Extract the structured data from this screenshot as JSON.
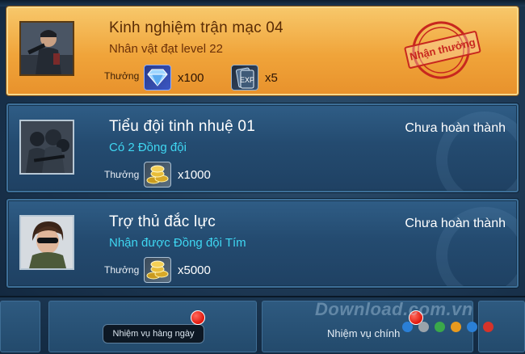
{
  "quests": [
    {
      "title": "Kinh nghiệm trận mạc 04",
      "subtitle": "Nhân vật đạt level 22",
      "reward_label": "Thưởng",
      "rewards": [
        {
          "icon": "diamond-icon",
          "count": "x100"
        },
        {
          "icon": "exp-card-icon",
          "count": "x5"
        }
      ],
      "action_label": "Nhận thưởng"
    },
    {
      "title": "Tiểu đội tinh nhuệ 01",
      "subtitle": "Có 2 Đồng đội",
      "reward_label": "Thưởng",
      "rewards": [
        {
          "icon": "gold-coins-icon",
          "count": "x1000"
        }
      ],
      "status": "Chưa hoàn thành"
    },
    {
      "title": "Trợ thủ đắc lực",
      "subtitle": "Nhận được Đồng đội Tím",
      "reward_label": "Thưởng",
      "rewards": [
        {
          "icon": "gold-coins-icon",
          "count": "x5000"
        }
      ],
      "status": "Chưa hoàn thành"
    }
  ],
  "tabs": {
    "daily": "Nhiệm vụ hàng ngày",
    "main": "Nhiệm vụ chính"
  },
  "watermark": "Download.com.vn",
  "colors": {
    "accent_cyan": "#3fd7f2",
    "gold_card": "#f0a43a",
    "stamp_red": "#c8271e",
    "badge_red": "#e0160c"
  }
}
